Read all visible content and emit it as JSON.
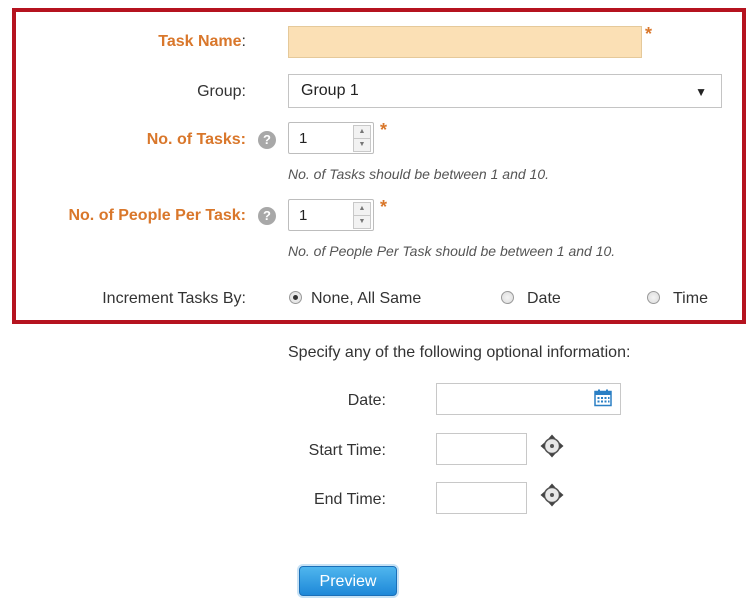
{
  "form": {
    "task_name": {
      "label": "Task Name",
      "colon": ":",
      "value": "",
      "star": "*"
    },
    "group": {
      "label": "Group:",
      "selected": "Group 1"
    },
    "num_tasks": {
      "label": "No. of Tasks:",
      "value": "1",
      "star": "*",
      "hint": "No. of Tasks should be between 1 and 10."
    },
    "people_per_task": {
      "label": "No. of People Per Task:",
      "value": "1",
      "star": "*",
      "hint": "No. of People Per Task should be between 1 and 10."
    },
    "increment": {
      "label": "Increment Tasks By:",
      "options": [
        {
          "label": "None, All Same",
          "checked": true
        },
        {
          "label": "Date",
          "checked": false
        },
        {
          "label": "Time",
          "checked": false
        }
      ]
    }
  },
  "optional": {
    "heading": "Specify any of the following optional information:",
    "date_label": "Date:",
    "start_time_label": "Start Time:",
    "end_time_label": "End Time:"
  },
  "preview_label": "Preview",
  "help_glyph": "?",
  "icons": [
    "help-icon",
    "calendar-icon",
    "time-picker-icon"
  ],
  "colors": {
    "required": "#d9772b",
    "highlight_border": "#b5131f",
    "button": "#1e88d8",
    "task_name_bg": "#fbe0b5"
  }
}
